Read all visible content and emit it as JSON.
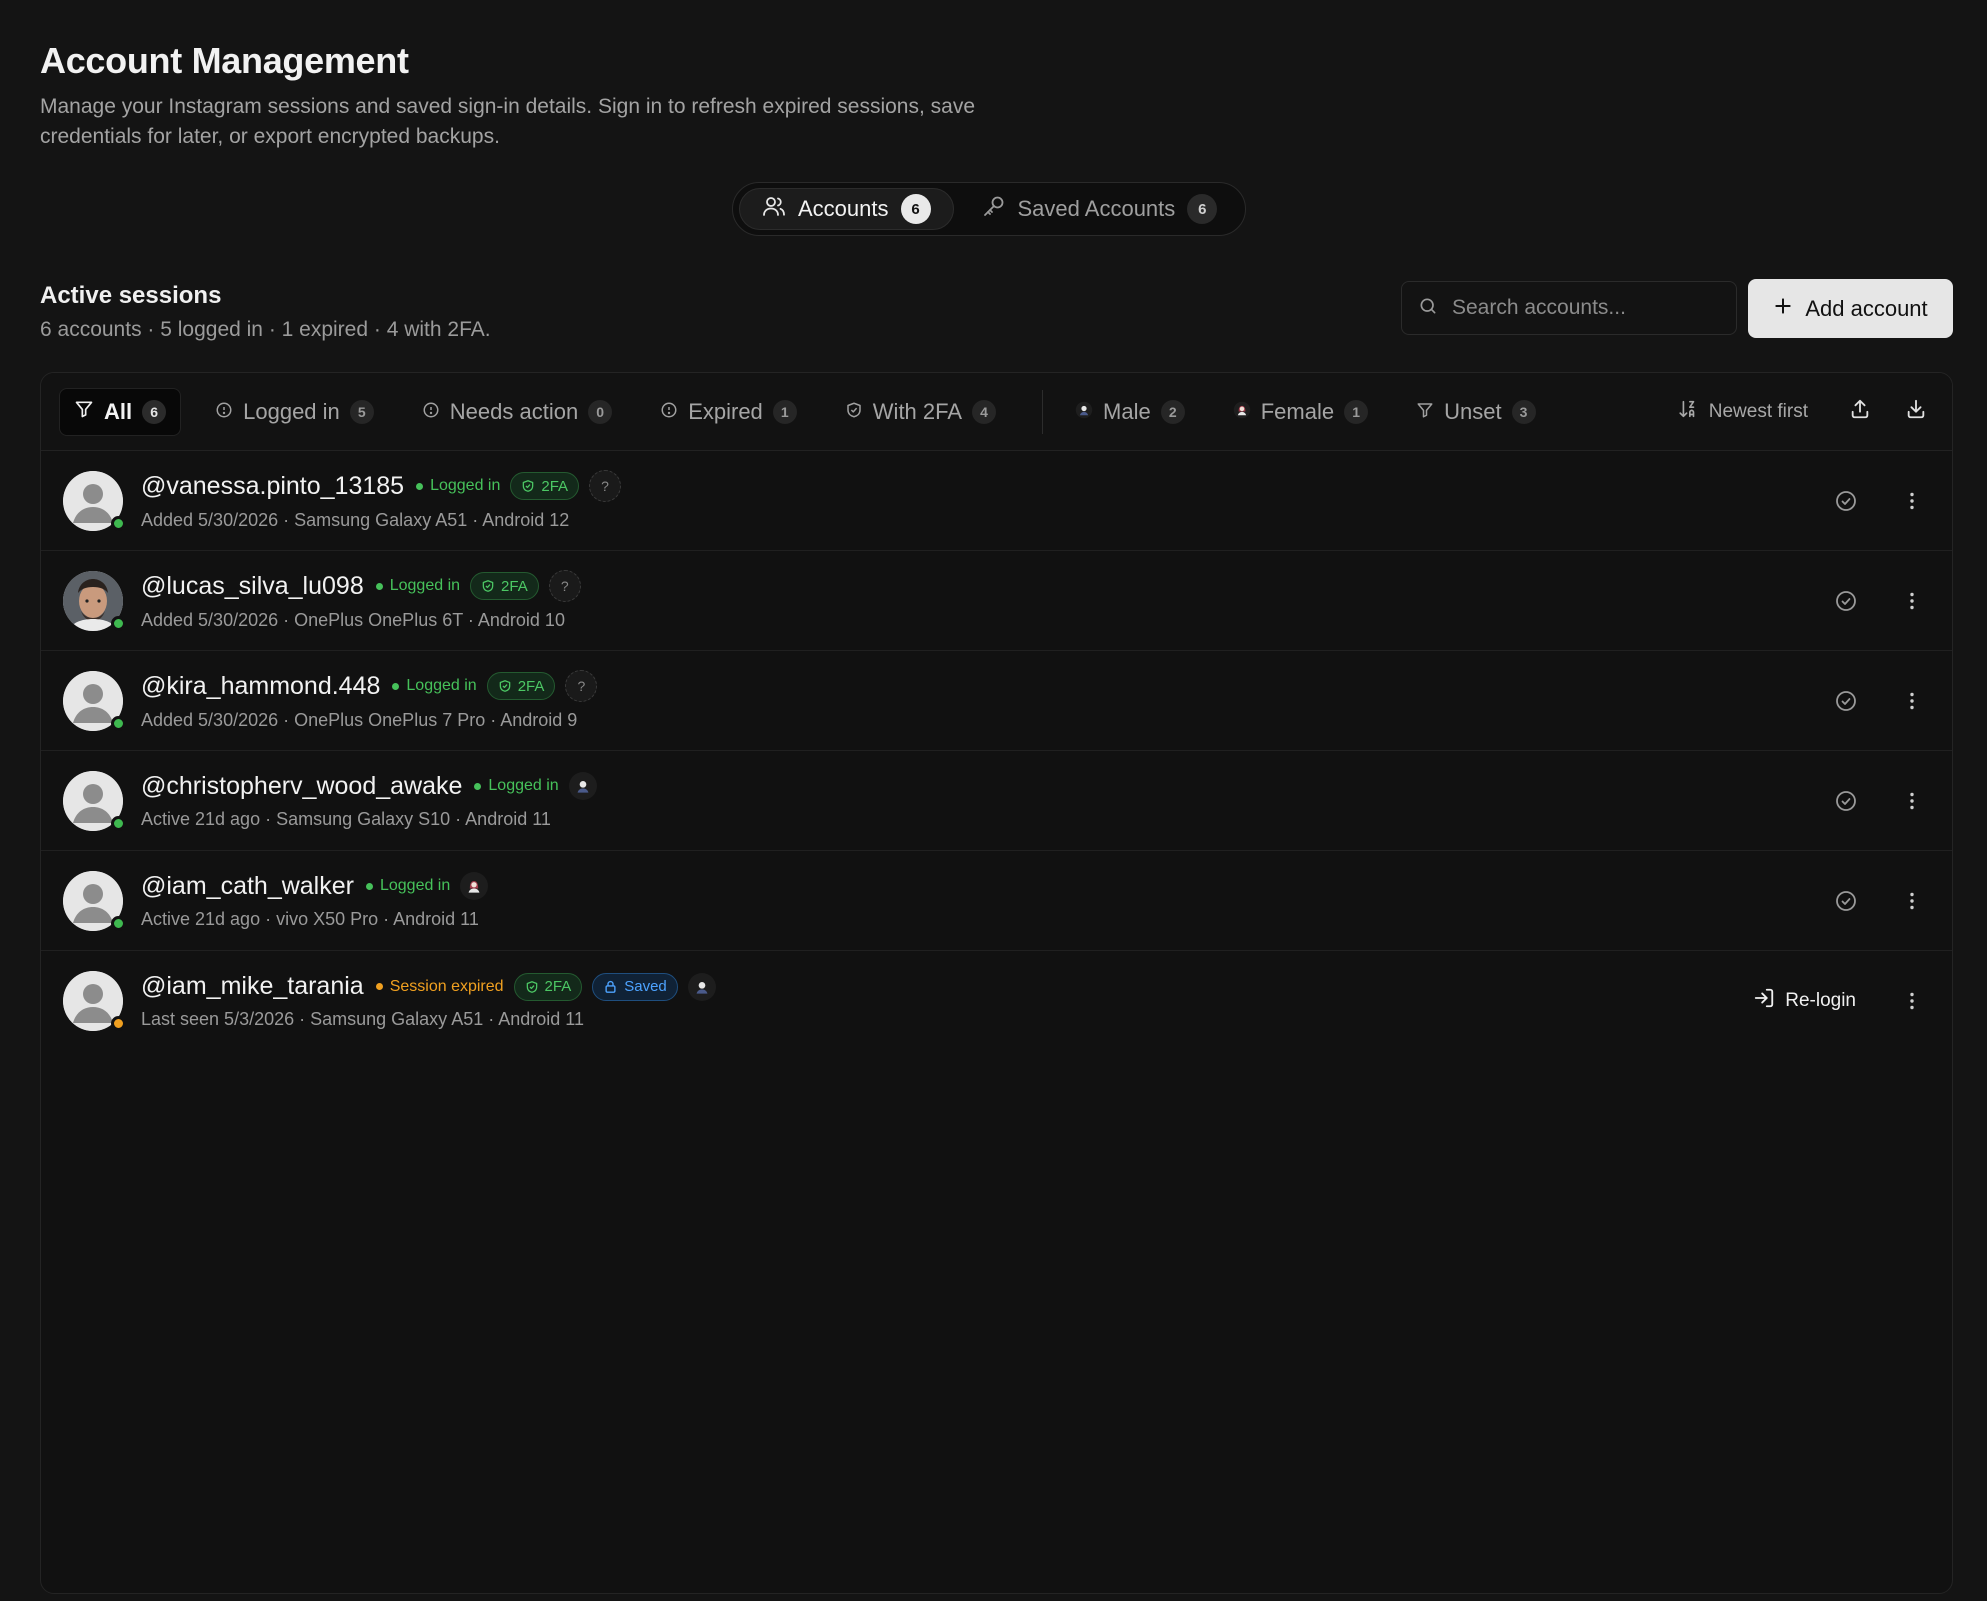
{
  "header": {
    "title": "Account Management",
    "description": "Manage your Instagram sessions and saved sign-in details. Sign in to refresh expired sessions, save credentials for later, or export encrypted backups."
  },
  "tabs": [
    {
      "label": "Accounts",
      "count": "6",
      "icon": "users-icon",
      "active": true
    },
    {
      "label": "Saved Accounts",
      "count": "6",
      "icon": "key-icon",
      "active": false
    }
  ],
  "section": {
    "title": "Active sessions",
    "summary": "6 accounts · 5 logged in · 1 expired · 4 with 2FA."
  },
  "search": {
    "placeholder": "Search accounts..."
  },
  "add_button": {
    "label": "Add account"
  },
  "filters": [
    {
      "label": "All",
      "count": "6",
      "icon": "filter-icon"
    },
    {
      "label": "Logged in",
      "count": "5",
      "icon": "circle-dot-icon"
    },
    {
      "label": "Needs action",
      "count": "0",
      "icon": "circle-dot-icon"
    },
    {
      "label": "Expired",
      "count": "1",
      "icon": "circle-dot-icon"
    },
    {
      "label": "With 2FA",
      "count": "4",
      "icon": "shield-icon"
    },
    {
      "label": "Male",
      "count": "2",
      "icon": "male-avatar-icon"
    },
    {
      "label": "Female",
      "count": "1",
      "icon": "female-avatar-icon"
    },
    {
      "label": "Unset",
      "count": "3",
      "icon": "filter-icon"
    }
  ],
  "sort": {
    "label": "Newest first"
  },
  "accounts": [
    {
      "handle": "@vanessa.pinto_13185",
      "status": "Logged in",
      "twofa": "2FA",
      "meta": "Added 5/30/2026 · Samsung Galaxy A51 · Android 12"
    },
    {
      "handle": "@lucas_silva_lu098",
      "status": "Logged in",
      "twofa": "2FA",
      "meta": "Added 5/30/2026 · OnePlus OnePlus 6T · Android 10"
    },
    {
      "handle": "@kira_hammond.448",
      "status": "Logged in",
      "twofa": "2FA",
      "meta": "Added 5/30/2026 · OnePlus OnePlus 7 Pro · Android 9"
    },
    {
      "handle": "@christopherv_wood_awake",
      "status": "Logged in",
      "meta": "Active 21d ago · Samsung Galaxy S10 · Android 11"
    },
    {
      "handle": "@iam_cath_walker",
      "status": "Logged in",
      "meta": "Active 21d ago · vivo X50 Pro · Android 11"
    },
    {
      "handle": "@iam_mike_tarania",
      "status": "Session expired",
      "twofa": "2FA",
      "saved": "Saved",
      "meta": "Last seen 5/3/2026 · Samsung Galaxy A51 · Android 11",
      "action": "Re-login"
    }
  ],
  "badges": {
    "unknown_gender": "?"
  },
  "colors": {
    "background": "#141414",
    "online": "#3fb950",
    "expired": "#f0a020",
    "twofa": "#4cc764",
    "saved": "#4da3ff"
  }
}
